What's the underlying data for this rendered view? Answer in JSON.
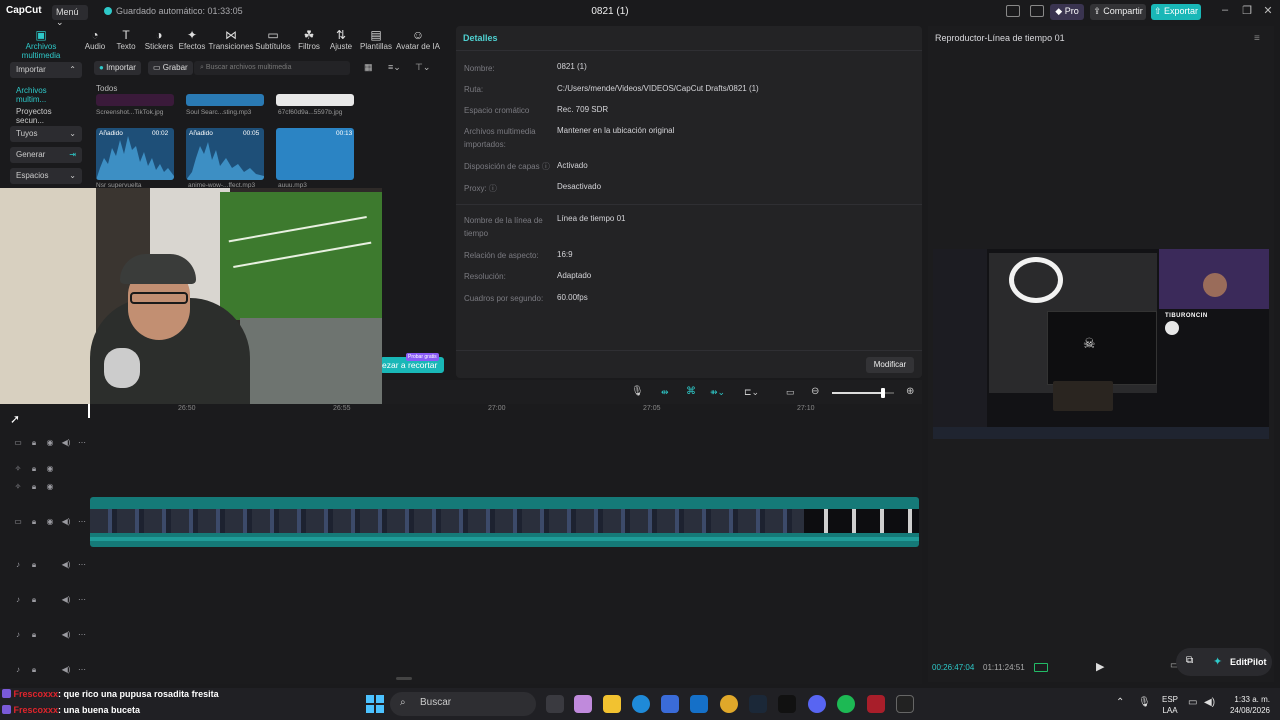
{
  "app": {
    "logo": "CapCut",
    "menu_label": "Menú",
    "autosave": "Guardado automático: 01:33:05",
    "project_title": "0821 (1)",
    "pro_label": "Pro",
    "share_label": "Compartir",
    "export_label": "Exportar"
  },
  "toolbar": [
    {
      "label": "Archivos multimedia",
      "icon": "media-icon",
      "active": true
    },
    {
      "label": "Audio",
      "icon": "audio-icon"
    },
    {
      "label": "Texto",
      "icon": "text-icon"
    },
    {
      "label": "Stickers",
      "icon": "sticker-icon"
    },
    {
      "label": "Efectos",
      "icon": "effects-icon"
    },
    {
      "label": "Transiciones",
      "icon": "transition-icon"
    },
    {
      "label": "Subtítulos",
      "icon": "subtitle-icon"
    },
    {
      "label": "Filtros",
      "icon": "filter-icon"
    },
    {
      "label": "Ajuste",
      "icon": "adjust-icon"
    },
    {
      "label": "Plantillas",
      "icon": "template-icon"
    },
    {
      "label": "Avatar de IA",
      "icon": "avatar-icon"
    }
  ],
  "sidebar": [
    {
      "label": "Importar"
    },
    {
      "label": "Archivos multim..."
    },
    {
      "label": "Proyectos secun..."
    },
    {
      "label": "Tuyos"
    },
    {
      "label": "Generar"
    },
    {
      "label": "Espacios"
    }
  ],
  "media": {
    "import_label": "Importar",
    "record_label": "Grabar",
    "search_placeholder": "Buscar archivos multimedia",
    "section_label": "Todos",
    "top_items": [
      {
        "name": "Screenshot...TikTok.jpg"
      },
      {
        "name": "Soul Searc...sting.mp3"
      },
      {
        "name": "67cf60d9a...5597b.jpg"
      }
    ],
    "items": [
      {
        "badge": "Añadido",
        "duration": "00:02",
        "name": "Nsr supervuelta"
      },
      {
        "badge": "Añadido",
        "duration": "00:05",
        "name": "anime-wow-...ffect.mp3"
      },
      {
        "badge": "",
        "duration": "00:13",
        "name": "auuu.mp3"
      }
    ],
    "promo_tag": "Probar gratis",
    "promo_label": "ezar a recortar"
  },
  "details": {
    "title": "Detalles",
    "rows": [
      {
        "k": "Nombre:",
        "v": "0821 (1)"
      },
      {
        "k": "Ruta:",
        "v": "C:/Users/mende/Videos/VIDEOS/CapCut Drafts/0821 (1)"
      },
      {
        "k": "Espacio cromático",
        "v": "Rec. 709 SDR"
      },
      {
        "k": "Archivos multimedia importados:",
        "v": "Mantener en la ubicación original"
      },
      {
        "k": "Disposición de capas ⓘ",
        "v": "Activado"
      },
      {
        "k": "Proxy: ⓘ",
        "v": "Desactivado"
      },
      {
        "k": "Nombre de la línea de tiempo",
        "v": "Línea de tiempo 01"
      },
      {
        "k": "Relación de aspecto:",
        "v": "16:9"
      },
      {
        "k": "Resolución:",
        "v": "Adaptado"
      },
      {
        "k": "Cuadros por segundo:",
        "v": "60.00fps"
      }
    ],
    "modify_label": "Modificar"
  },
  "player": {
    "title": "Reproductor-Línea de tiempo 01",
    "current_time": "00:26:47:04",
    "total_time": "01:11:24:51",
    "stream_name": "TIBURONCIN",
    "editpilot_label": "EditPilot"
  },
  "timeline": {
    "ruler": [
      "26:50",
      "26:55",
      "27:00",
      "27:05",
      "27:10"
    ],
    "zoom": 0.82
  },
  "chat": [
    {
      "user": "Frescoxxx",
      "msg": ": que rico una pupusa rosadita fresita"
    },
    {
      "user": "Frescoxxx",
      "msg": ": una buena buceta"
    }
  ],
  "taskbar": {
    "search_label": "Buscar",
    "lang_top": "ESP",
    "lang_bottom": "LAA",
    "time": "1:33 a. m.",
    "date": "24/08/2026"
  },
  "colors": {
    "accent": "#2ec9c9",
    "export": "#19b7b7",
    "track": "#157a78",
    "chat_user": "#e0242c"
  }
}
